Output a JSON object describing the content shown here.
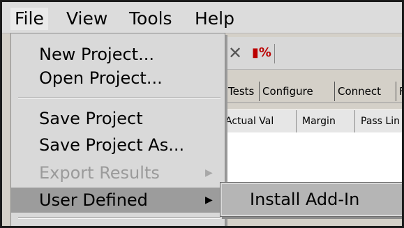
{
  "menubar": {
    "file": "File",
    "view": "View",
    "tools": "Tools",
    "help": "Help"
  },
  "toolbar": {
    "icons": [
      "close-x-icon",
      "battery-percent-icon"
    ]
  },
  "tabs": [
    "Tests",
    "Configure",
    "Connect",
    "F"
  ],
  "grid": {
    "columns": [
      "Actual Val",
      "Margin",
      "Pass Lin"
    ]
  },
  "file_menu": {
    "new_project": "New Project...",
    "open_project": "Open Project...",
    "save_project": "Save Project",
    "save_project_as": "Save Project As...",
    "export_results": "Export Results",
    "user_defined": "User Defined"
  },
  "submenu": {
    "install_add_in": "Install Add-In"
  },
  "colors": {
    "menu_bg": "#d9d9d9",
    "highlight": "#9c9c9c",
    "disabled_text": "#9a9a9a"
  }
}
